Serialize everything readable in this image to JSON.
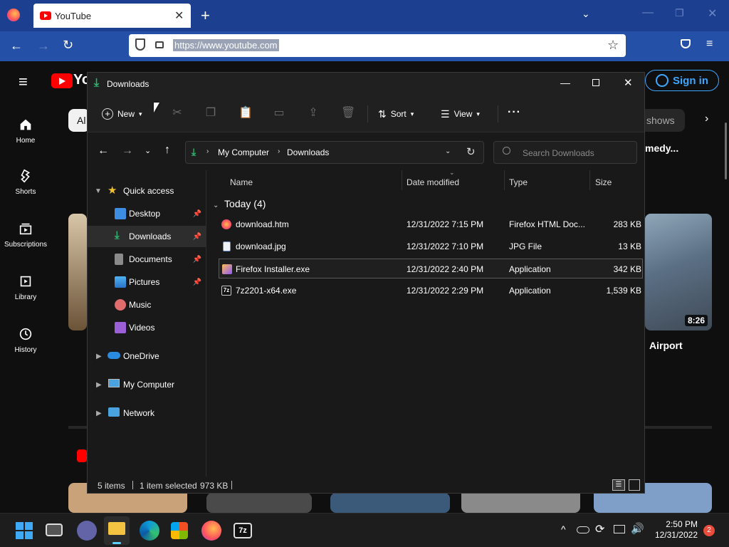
{
  "browser": {
    "tab_title": "YouTube",
    "url": "https://www.youtube.com"
  },
  "youtube": {
    "sign_in": "Sign in",
    "nav": [
      {
        "label": "Home",
        "icon": "home-icon"
      },
      {
        "label": "Shorts",
        "icon": "shorts-icon"
      },
      {
        "label": "Subscriptions",
        "icon": "subscriptions-icon"
      },
      {
        "label": "Library",
        "icon": "library-icon"
      },
      {
        "label": "History",
        "icon": "history-icon"
      }
    ],
    "chip_all": "Al",
    "chip_shows": "shows",
    "video_title_right": "medy...",
    "video_duration": "8:26",
    "video_title_airport": "Airport"
  },
  "explorer": {
    "title": "Downloads",
    "toolbar": {
      "new_label": "New",
      "sort_label": "Sort",
      "view_label": "View",
      "more_label": "···"
    },
    "breadcrumb": [
      "My Computer",
      "Downloads"
    ],
    "search_placeholder": "Search Downloads",
    "sidebar": [
      {
        "label": "Quick access",
        "icon": "star-icon",
        "level": 0,
        "expanded": true
      },
      {
        "label": "Desktop",
        "icon": "desktop-icon",
        "level": 1,
        "pinned": true
      },
      {
        "label": "Downloads",
        "icon": "download-icon",
        "level": 1,
        "pinned": true,
        "selected": true
      },
      {
        "label": "Documents",
        "icon": "documents-icon",
        "level": 1,
        "pinned": true
      },
      {
        "label": "Pictures",
        "icon": "pictures-icon",
        "level": 1,
        "pinned": true
      },
      {
        "label": "Music",
        "icon": "music-icon",
        "level": 1
      },
      {
        "label": "Videos",
        "icon": "videos-icon",
        "level": 1
      },
      {
        "label": "OneDrive",
        "icon": "onedrive-icon",
        "level": 0
      },
      {
        "label": "My Computer",
        "icon": "computer-icon",
        "level": 0
      },
      {
        "label": "Network",
        "icon": "network-icon",
        "level": 0
      }
    ],
    "columns": {
      "name": "Name",
      "date": "Date modified",
      "type": "Type",
      "size": "Size"
    },
    "group_label": "Today (4)",
    "files": [
      {
        "name": "download.htm",
        "date": "12/31/2022 7:15 PM",
        "type": "Firefox HTML Doc...",
        "size": "283 KB",
        "icon": "firefox-html-icon"
      },
      {
        "name": "download.jpg",
        "date": "12/31/2022 7:10 PM",
        "type": "JPG File",
        "size": "13 KB",
        "icon": "jpg-file-icon"
      },
      {
        "name": "Firefox Installer.exe",
        "date": "12/31/2022 2:40 PM",
        "type": "Application",
        "size": "342 KB",
        "icon": "firefox-installer-icon",
        "selected": true
      },
      {
        "name": "7z2201-x64.exe",
        "date": "12/31/2022 2:29 PM",
        "type": "Application",
        "size": "1,539 KB",
        "icon": "7zip-icon"
      }
    ],
    "status": {
      "items": "5 items",
      "selected": "1 item selected",
      "size": "973 KB"
    }
  },
  "taskbar": {
    "time": "2:50 PM",
    "date": "12/31/2022",
    "notification_count": "2"
  },
  "colors": {
    "firefox_tabbar": "#1c3f8f",
    "firefox_navbar": "#2450a8",
    "explorer_bg": "#191919",
    "accent_blue": "#3ea6ff",
    "download_green": "#2fb36e"
  }
}
